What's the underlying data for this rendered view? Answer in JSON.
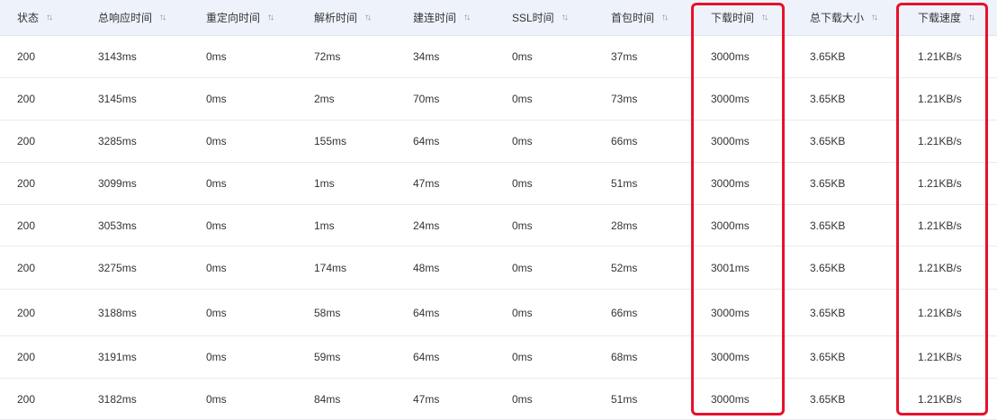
{
  "columns": [
    {
      "label": "状态"
    },
    {
      "label": "总响应时间"
    },
    {
      "label": "重定向时间"
    },
    {
      "label": "解析时间"
    },
    {
      "label": "建连时间"
    },
    {
      "label": "SSL时间"
    },
    {
      "label": "首包时间"
    },
    {
      "label": "下载时间"
    },
    {
      "label": "总下载大小"
    },
    {
      "label": "下载速度"
    }
  ],
  "sort_icon": "sort-icon",
  "highlight_color": "#e8102a",
  "highlighted_columns": [
    "下载时间",
    "下载速度"
  ],
  "rows": [
    [
      "200",
      "3143ms",
      "0ms",
      "72ms",
      "34ms",
      "0ms",
      "37ms",
      "3000ms",
      "3.65KB",
      "1.21KB/s"
    ],
    [
      "200",
      "3145ms",
      "0ms",
      "2ms",
      "70ms",
      "0ms",
      "73ms",
      "3000ms",
      "3.65KB",
      "1.21KB/s"
    ],
    [
      "200",
      "3285ms",
      "0ms",
      "155ms",
      "64ms",
      "0ms",
      "66ms",
      "3000ms",
      "3.65KB",
      "1.21KB/s"
    ],
    [
      "200",
      "3099ms",
      "0ms",
      "1ms",
      "47ms",
      "0ms",
      "51ms",
      "3000ms",
      "3.65KB",
      "1.21KB/s"
    ],
    [
      "200",
      "3053ms",
      "0ms",
      "1ms",
      "24ms",
      "0ms",
      "28ms",
      "3000ms",
      "3.65KB",
      "1.21KB/s"
    ],
    [
      "200",
      "3275ms",
      "0ms",
      "174ms",
      "48ms",
      "0ms",
      "52ms",
      "3001ms",
      "3.65KB",
      "1.21KB/s"
    ],
    [
      "200",
      "3188ms",
      "0ms",
      "58ms",
      "64ms",
      "0ms",
      "66ms",
      "3000ms",
      "3.65KB",
      "1.21KB/s"
    ],
    [
      "200",
      "3191ms",
      "0ms",
      "59ms",
      "64ms",
      "0ms",
      "68ms",
      "3000ms",
      "3.65KB",
      "1.21KB/s"
    ],
    [
      "200",
      "3182ms",
      "0ms",
      "84ms",
      "47ms",
      "0ms",
      "51ms",
      "3000ms",
      "3.65KB",
      "1.21KB/s"
    ]
  ]
}
